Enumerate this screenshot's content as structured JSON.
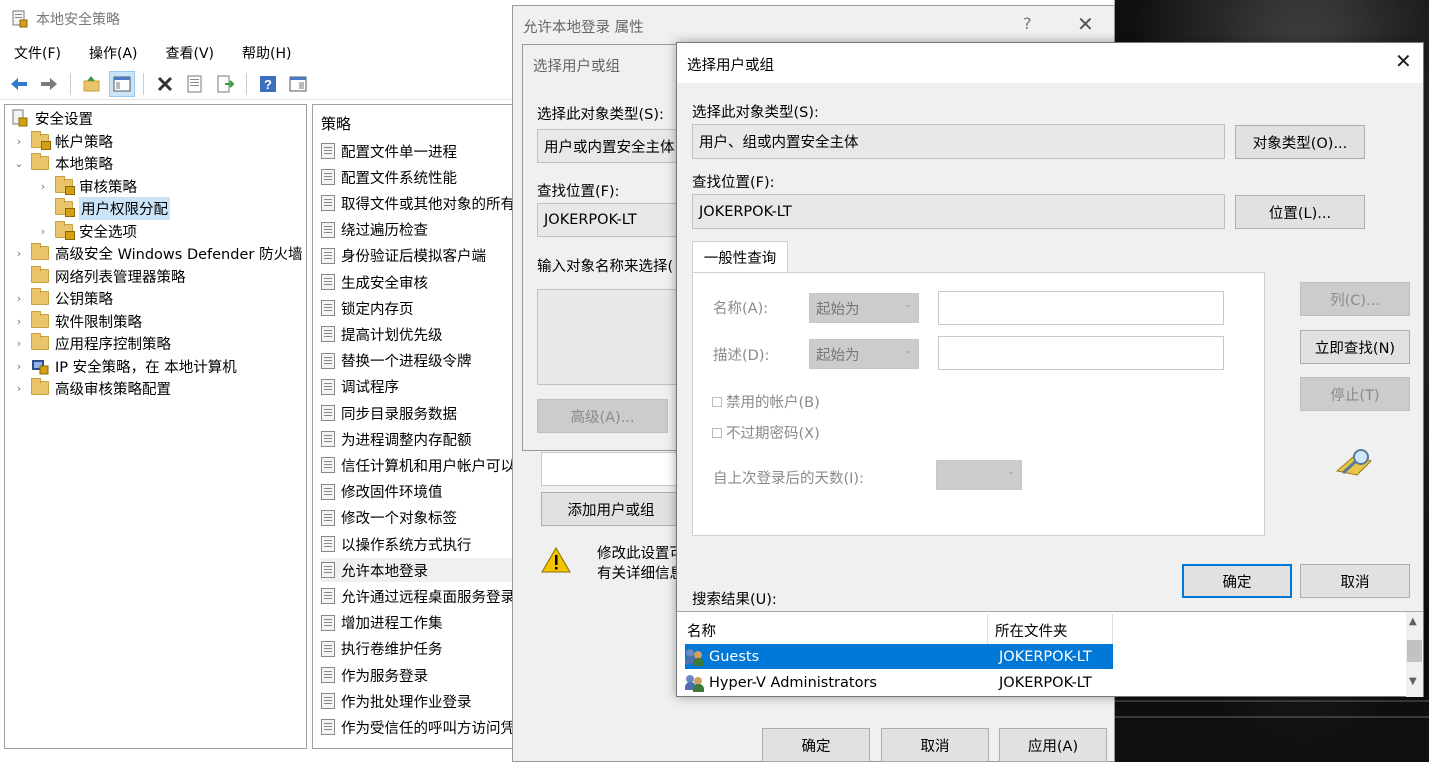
{
  "mmc": {
    "title": "本地安全策略",
    "menu": [
      "文件(F)",
      "操作(A)",
      "查看(V)",
      "帮助(H)"
    ],
    "tree": [
      {
        "label": "安全设置",
        "level": 0,
        "chevron": "",
        "icon": "security-settings"
      },
      {
        "label": "帐户策略",
        "level": 1,
        "chevron": "›",
        "icon": "folder-lock"
      },
      {
        "label": "本地策略",
        "level": 1,
        "chevron": "⌄",
        "icon": "folder"
      },
      {
        "label": "审核策略",
        "level": 2,
        "chevron": "›",
        "icon": "folder-lock"
      },
      {
        "label": "用户权限分配",
        "level": 2,
        "chevron": "",
        "icon": "folder-lock",
        "selected": true
      },
      {
        "label": "安全选项",
        "level": 2,
        "chevron": "›",
        "icon": "folder-lock"
      },
      {
        "label": "高级安全 Windows Defender 防火墙",
        "level": 1,
        "chevron": "›",
        "icon": "folder"
      },
      {
        "label": "网络列表管理器策略",
        "level": 1,
        "chevron": "",
        "icon": "folder"
      },
      {
        "label": "公钥策略",
        "level": 1,
        "chevron": "›",
        "icon": "folder"
      },
      {
        "label": "软件限制策略",
        "level": 1,
        "chevron": "›",
        "icon": "folder"
      },
      {
        "label": "应用程序控制策略",
        "level": 1,
        "chevron": "›",
        "icon": "folder"
      },
      {
        "label": "IP 安全策略，在 本地计算机",
        "level": 1,
        "chevron": "›",
        "icon": "ip-security"
      },
      {
        "label": "高级审核策略配置",
        "level": 1,
        "chevron": "›",
        "icon": "folder"
      }
    ],
    "policy_header": "策略",
    "policies": [
      "配置文件单一进程",
      "配置文件系统性能",
      "取得文件或其他对象的所有",
      "绕过遍历检查",
      "身份验证后模拟客户端",
      "生成安全审核",
      "锁定内存页",
      "提高计划优先级",
      "替换一个进程级令牌",
      "调试程序",
      "同步目录服务数据",
      "为进程调整内存配额",
      "信任计算机和用户帐户可以",
      "修改固件环境值",
      "修改一个对象标签",
      "以操作系统方式执行",
      "允许本地登录",
      "允许通过远程桌面服务登录",
      "增加进程工作集",
      "执行卷维护任务",
      "作为服务登录",
      "作为批处理作业登录",
      "作为受信任的呼叫方访问凭"
    ],
    "highlighted_policy": "允许本地登录"
  },
  "props": {
    "title": "允许本地登录 属性",
    "help": "?",
    "close": "✕",
    "add_button": "添加用户或组",
    "warning_line1": "修改此设置可",
    "warning_line2": "有关详细信息",
    "ok": "确定",
    "cancel": "取消",
    "apply": "应用(A)"
  },
  "old_select": {
    "title": "选择用户或组",
    "obj_type_label": "选择此对象类型(S):",
    "obj_type_value": "用户或内置安全主体",
    "location_label": "查找位置(F):",
    "location_value": "JOKERPOK-LT",
    "enter_label": "输入对象名称来选择(",
    "advanced": "高级(A)..."
  },
  "select": {
    "title": "选择用户或组",
    "close": "✕",
    "obj_type_label": "选择此对象类型(S):",
    "obj_type_value": "用户、组或内置安全主体",
    "obj_type_button": "对象类型(O)...",
    "location_label": "查找位置(F):",
    "location_value": "JOKERPOK-LT",
    "location_button": "位置(L)...",
    "tab": "一般性查询",
    "name_label": "名称(A):",
    "name_combo": "起始为",
    "desc_label": "描述(D):",
    "desc_combo": "起始为",
    "disabled_accounts": "禁用的帐户(B)",
    "no_expire_pwd": "不过期密码(X)",
    "days_since_login": "自上次登录后的天数(I):",
    "columns_button": "列(C)...",
    "find_now_button": "立即查找(N)",
    "stop_button": "停止(T)",
    "ok": "确定",
    "cancel": "取消",
    "results_label": "搜索结果(U):",
    "results_headers": {
      "name": "名称",
      "folder": "所在文件夹"
    },
    "results": [
      {
        "name": "Guests",
        "folder": "JOKERPOK-LT",
        "selected": true
      },
      {
        "name": "Hyper-V Administrators",
        "folder": "JOKERPOK-LT",
        "selected": false
      }
    ]
  },
  "colors": {
    "selection": "#0078d7",
    "tree_selection": "#cce4f7",
    "dialog_bg": "#f0f0f0"
  }
}
